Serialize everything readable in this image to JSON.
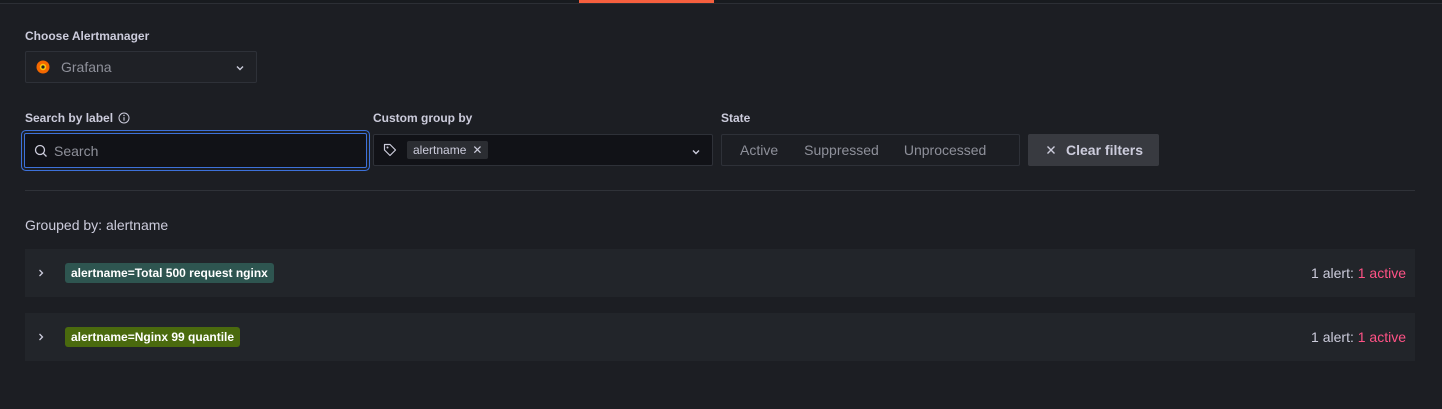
{
  "alertmanager": {
    "label": "Choose Alertmanager",
    "selected": "Grafana"
  },
  "filters": {
    "search_label": "Search by label",
    "search_placeholder": "Search",
    "group_label": "Custom group by",
    "group_chip": "alertname",
    "state_label": "State",
    "states": [
      "Active",
      "Suppressed",
      "Unprocessed"
    ],
    "clear_label": "Clear filters"
  },
  "grouped_by_text": "Grouped by: alertname",
  "groups": [
    {
      "label": "alertname=Total 500 request nginx",
      "label_color": "#2e5550",
      "count_prefix": "1 alert:",
      "count_active": "1 active"
    },
    {
      "label": "alertname=Nginx 99 quantile",
      "label_color": "#4a6a0e",
      "count_prefix": "1 alert:",
      "count_active": "1 active"
    }
  ],
  "colors": {
    "accent_focus": "#3d71d9",
    "active_text": "#ff5286",
    "tab_accent": "#f55f3e"
  }
}
